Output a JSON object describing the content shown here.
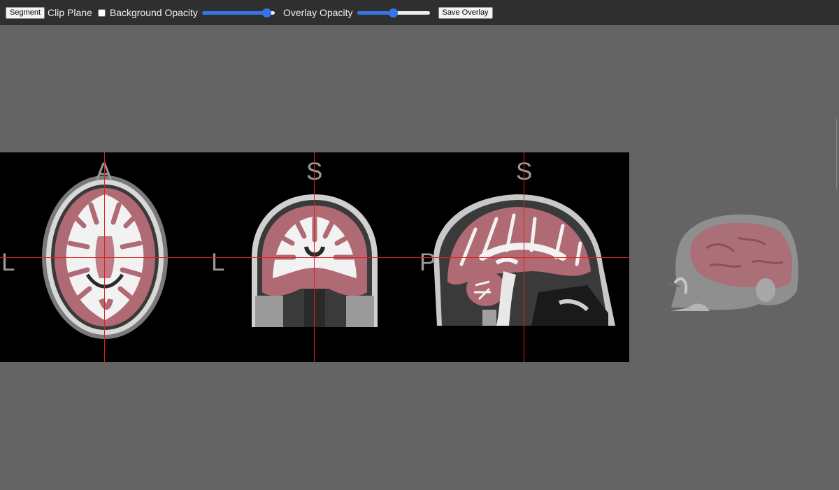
{
  "toolbar": {
    "segment_label": "Segment",
    "clip_plane_label": "Clip Plane",
    "clip_plane_checked": false,
    "background_opacity_label": "Background Opacity",
    "background_opacity_value": 0.95,
    "overlay_opacity_label": "Overlay Opacity",
    "overlay_opacity_value": 0.5,
    "save_overlay_label": "Save Overlay"
  },
  "views": {
    "axial": {
      "top_label": "A",
      "left_label": "L"
    },
    "coronal": {
      "top_label": "S",
      "left_label": "L"
    },
    "sagittal": {
      "top_label": "S",
      "left_label": "P"
    }
  },
  "colors": {
    "background": "#646464",
    "toolbar": "#2f2f2f",
    "crosshair": "#e02020",
    "overlay": "#c8707a",
    "slider_accent": "#3874e8"
  }
}
